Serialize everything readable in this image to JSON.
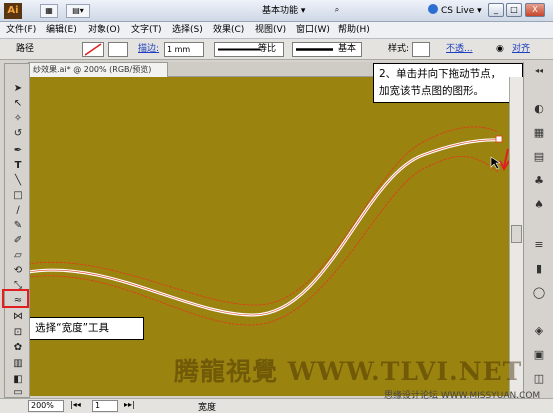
{
  "titlebar": {
    "app_logo": "Ai",
    "workspace": "基本功能 ▾",
    "cslive": "CS Live ▾",
    "controls": [
      "_",
      "□",
      "X"
    ]
  },
  "menubar": {
    "items": [
      "文件(F)",
      "编辑(E)",
      "对象(O)",
      "文字(T)",
      "选择(S)",
      "效果(C)",
      "视图(V)",
      "窗口(W)",
      "帮助(H)"
    ]
  },
  "control_bar": {
    "selection_label": "路径",
    "stroke_label": "描边:",
    "stroke_weight": "1 mm",
    "profile_label": "等比",
    "brush_label": "基本",
    "style_label": "样式:",
    "opacity_label": "不透...",
    "arrange_label": "对齐"
  },
  "document_tab": {
    "title": "纱效果.ai* @ 200% (RGB/预览)"
  },
  "callouts": {
    "step1": "1、选择“宽度”工具",
    "step2_line1": "2、单击并向下拖动节点，",
    "step2_line2": "加宽该节点图的图形。"
  },
  "statusbar": {
    "zoom": "200%",
    "page": "1",
    "tool_name": "宽度"
  },
  "watermarks": {
    "main": "腾龍視覺 WWW.TLVI.NET",
    "corner": "思缘设计论坛 WWW.MISSYUAN.COM"
  },
  "colors": {
    "canvas": "#9b8310",
    "path_stroke": "#ffffff",
    "width_outline": "#e03a1a",
    "highlight": "#e02020"
  }
}
